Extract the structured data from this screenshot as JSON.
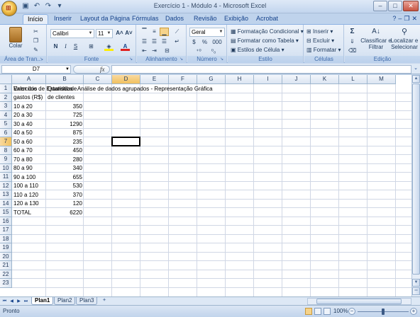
{
  "window": {
    "title": "Exercício 1 - Módulo 4 - Microsoft Excel",
    "qat_icons": [
      "save-icon",
      "undo-icon",
      "redo-icon",
      "customize-icon"
    ]
  },
  "tabs": [
    {
      "label": "Início",
      "active": true
    },
    {
      "label": "Inserir"
    },
    {
      "label": "Layout da Página"
    },
    {
      "label": "Fórmulas"
    },
    {
      "label": "Dados"
    },
    {
      "label": "Revisão"
    },
    {
      "label": "Exibição"
    },
    {
      "label": "Acrobat"
    }
  ],
  "ribbon": {
    "clipboard": {
      "label": "Área de Tran...",
      "paste": "Colar"
    },
    "font": {
      "label": "Fonte",
      "name": "Calibri",
      "size": "11"
    },
    "alignment": {
      "label": "Alinhamento"
    },
    "number": {
      "label": "Número",
      "format": "Geral"
    },
    "styles": {
      "label": "Estilo",
      "conditional": "Formatação Condicional",
      "as_table": "Formatar como Tabela",
      "cell_styles": "Estilos de Célula"
    },
    "cells": {
      "label": "Células",
      "insert": "Inserir",
      "delete": "Excluir",
      "format": "Formatar"
    },
    "editing": {
      "label": "Edição",
      "sort": "Classificar e Filtrar",
      "find": "Localizar e Selecionar"
    }
  },
  "formula_bar": {
    "name_box": "D7",
    "fx": "fx",
    "content": ""
  },
  "grid": {
    "columns": [
      "A",
      "B",
      "C",
      "D",
      "E",
      "F",
      "G",
      "H",
      "I",
      "J",
      "K",
      "L",
      "M"
    ],
    "selected_col": "D",
    "selected_row": 7,
    "rows": [
      1,
      2,
      3,
      4,
      5,
      6,
      7,
      8,
      9,
      10,
      11,
      12,
      13,
      14,
      15,
      16,
      17,
      18,
      19,
      20,
      21,
      22,
      23
    ],
    "title": "Exercício de Estatística - Análise de dados agrupados - Representação Gráfica",
    "header_a": [
      "Valor dos",
      "gastos (R$)"
    ],
    "header_b": [
      "Quantidade",
      "de clientes"
    ],
    "data": [
      {
        "range": "10 a 20",
        "count": "350"
      },
      {
        "range": "20 a 30",
        "count": "725"
      },
      {
        "range": "30 a 40",
        "count": "1290"
      },
      {
        "range": "40 a 50",
        "count": "875"
      },
      {
        "range": "50 a 60",
        "count": "235"
      },
      {
        "range": "60 a 70",
        "count": "450"
      },
      {
        "range": "70 a 80",
        "count": "280"
      },
      {
        "range": "80 a 90",
        "count": "340"
      },
      {
        "range": "90 a 100",
        "count": "655"
      },
      {
        "range": "100 a 110",
        "count": "530"
      },
      {
        "range": "110 a 120",
        "count": "370"
      },
      {
        "range": "120 a 130",
        "count": "120"
      }
    ],
    "total": {
      "label": "TOTAL",
      "value": "6220"
    }
  },
  "sheets": [
    {
      "label": "Plan1",
      "active": true
    },
    {
      "label": "Plan2"
    },
    {
      "label": "Plan3"
    }
  ],
  "status": {
    "text": "Pronto",
    "zoom": "100%",
    "zoom_level_fraction": 0.5
  }
}
